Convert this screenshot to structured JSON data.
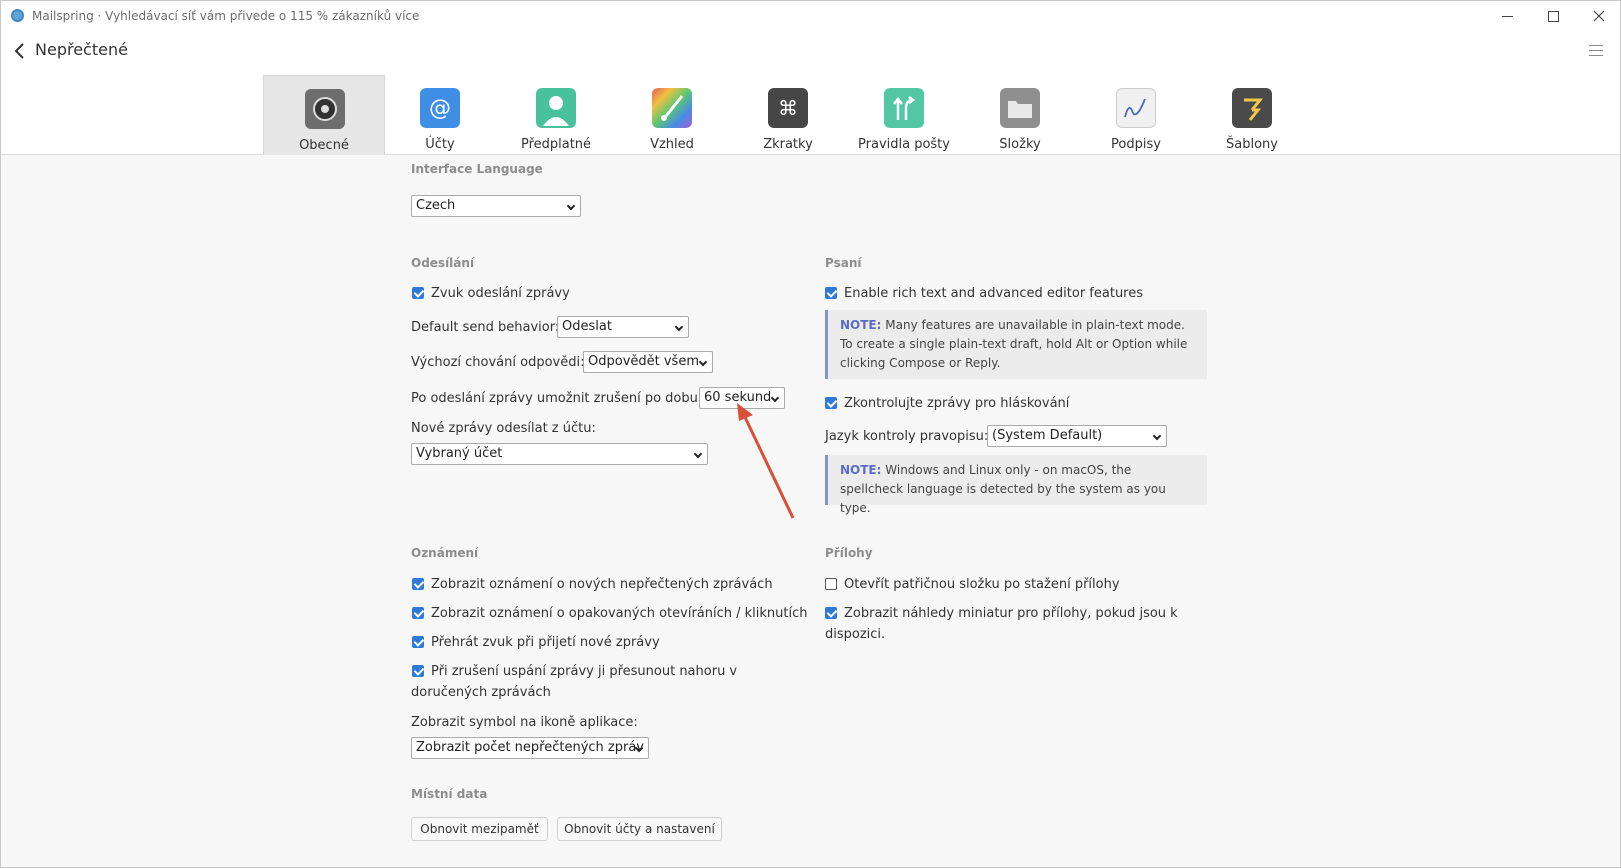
{
  "window": {
    "title": "Mailspring · Vyhledávací síť vám přivede o 115 % zákazníků více"
  },
  "toolbar": {
    "back_title": "Nepřečtené"
  },
  "tabs": [
    {
      "label": "Obecné",
      "icon": "gear-icon",
      "color": "#6d6d6d"
    },
    {
      "label": "Účty",
      "icon": "at-icon",
      "color": "#3f8ee6"
    },
    {
      "label": "Předplatné",
      "icon": "person-icon",
      "color": "#49c19c"
    },
    {
      "label": "Vzhled",
      "icon": "brush-icon",
      "color": "#e98d4d"
    },
    {
      "label": "Zkratky",
      "icon": "command-icon",
      "color": "#464646"
    },
    {
      "label": "Pravidla pošty",
      "icon": "arrows-icon",
      "color": "#52c7a2"
    },
    {
      "label": "Složky",
      "icon": "folder-icon",
      "color": "#8f8f8f"
    },
    {
      "label": "Podpisy",
      "icon": "signature-icon",
      "color": "#f0f0f0"
    },
    {
      "label": "Šablony",
      "icon": "template-icon",
      "color": "#4a4a4a"
    }
  ],
  "language": {
    "heading": "Interface Language",
    "value": "Czech"
  },
  "sending": {
    "heading": "Odesílání",
    "sound_label": "Zvuk odeslání zprávy",
    "sound_checked": true,
    "send_behavior_label": "Default send behavior:",
    "send_behavior_value": "Odeslat",
    "reply_behavior_label": "Výchozí chování odpovědi:",
    "reply_behavior_value": "Odpovědět všem",
    "undo_label": "Po odeslání zprávy umožnit zrušení po dobu::",
    "undo_value": "60 sekund",
    "from_label": "Nové zprávy odesílat z účtu:",
    "from_value": "Vybraný účet"
  },
  "writing": {
    "heading": "Psaní",
    "rich_text_label": "Enable rich text and advanced editor features",
    "rich_text_checked": true,
    "note1_label": "NOTE:",
    "note1_text": " Many features are unavailable in plain-text mode. To create a single plain-text draft, hold Alt or Option while clicking Compose or Reply.",
    "spellcheck_label": "Zkontrolujte zprávy pro hláskování",
    "spellcheck_checked": true,
    "spell_lang_label": "Jazyk kontroly pravopisu:",
    "spell_lang_value": "(System Default)",
    "note2_label": "NOTE:",
    "note2_text": " Windows and Linux only - on macOS, the spellcheck language is detected by the system as you type."
  },
  "notifications": {
    "heading": "Oznámení",
    "items": [
      {
        "label": "Zobrazit oznámení o nových nepřečtených zprávách",
        "checked": true
      },
      {
        "label": "Zobrazit oznámení o opakovaných otevíráních / kliknutích",
        "checked": true
      },
      {
        "label": "Přehrát zvuk při přijetí nové zprávy",
        "checked": true
      },
      {
        "label": "Při zrušení uspání zprávy ji přesunout nahoru v doručených zprávách",
        "checked": true
      }
    ],
    "badge_label": "Zobrazit symbol na ikoně aplikace:",
    "badge_value": "Zobrazit počet nepřečtených zpráv"
  },
  "attachments": {
    "heading": "Přílohy",
    "open_folder_label": "Otevřít patřičnou složku po stažení přílohy",
    "open_folder_checked": false,
    "thumbnails_label": "Zobrazit náhledy miniatur pro přílohy, pokud jsou k dispozici.",
    "thumbnails_checked": true
  },
  "local_data": {
    "heading": "Místní data",
    "clear_cache_label": "Obnovit mezipaměť",
    "reset_label": "Obnovit účty a nastavení"
  },
  "annotation_color": "#d9503a"
}
